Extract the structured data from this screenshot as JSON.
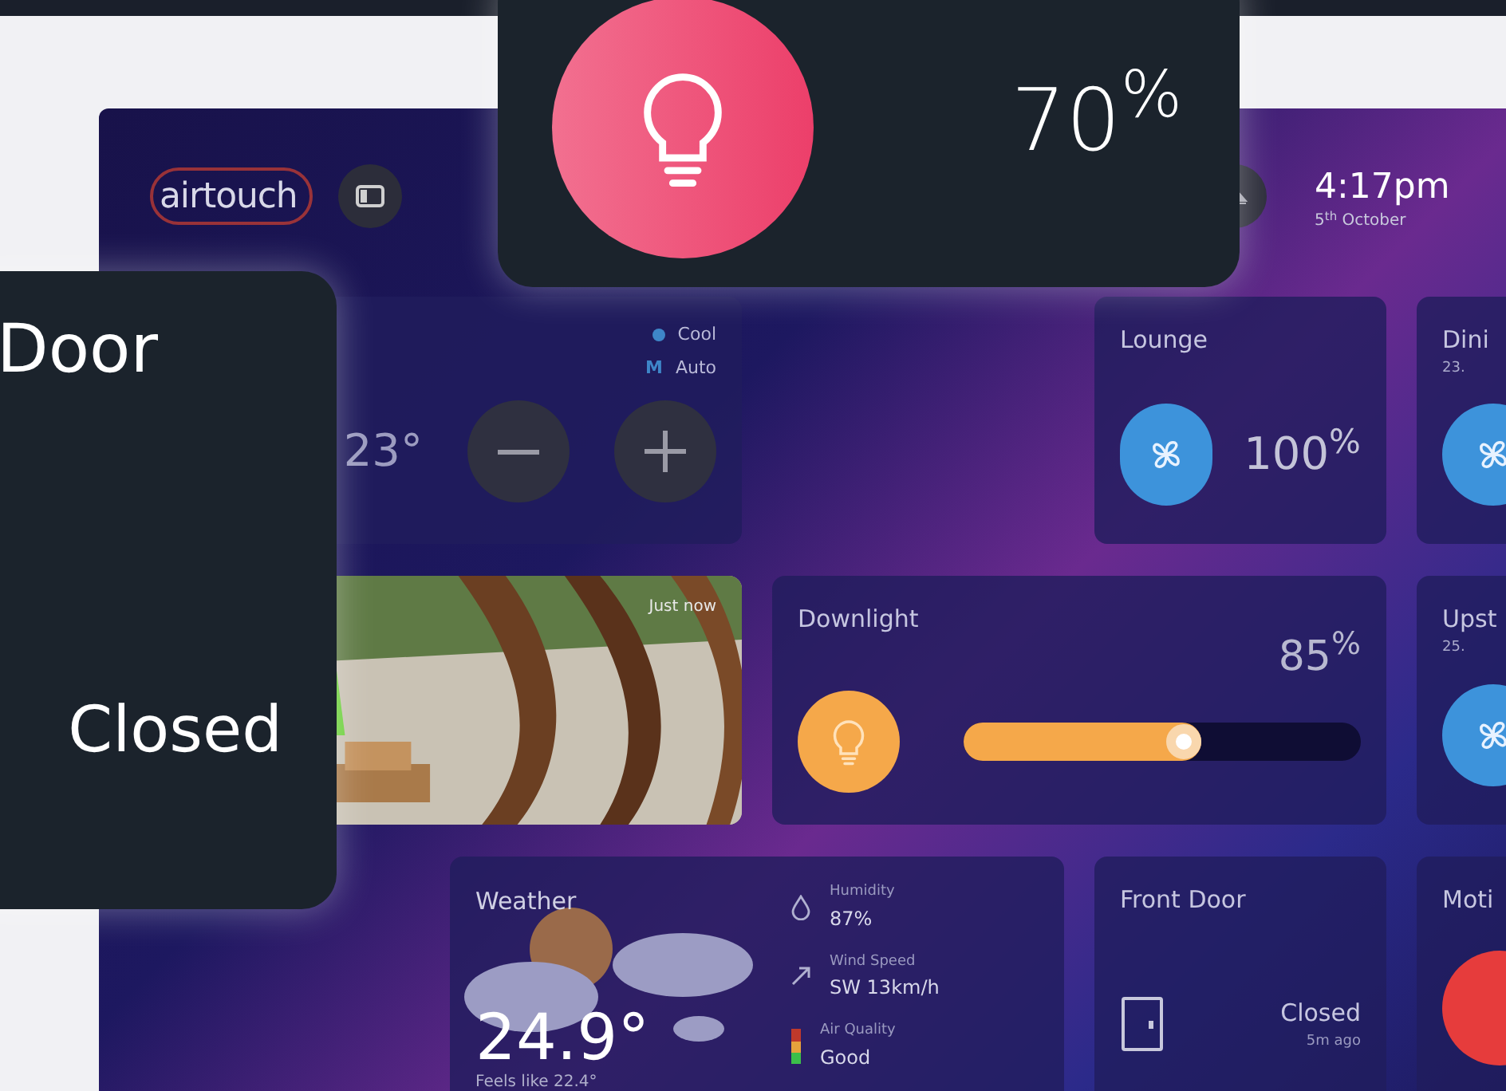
{
  "header": {
    "logo": "airtouch",
    "time": "4:17pm",
    "date": "5$^{th}$ October"
  },
  "aircon": {
    "modes": [
      {
        "kind": "dot",
        "label": "Cool"
      },
      {
        "kind": "letter",
        "letter": "M",
        "label": "Auto"
      }
    ],
    "setpoint": "23°"
  },
  "rooms": [
    {
      "name": "Lounge",
      "value": "100$^{%}$"
    },
    {
      "name": "Dini",
      "reading": "23."
    }
  ],
  "camera": {
    "caption": "Just now"
  },
  "downlight": {
    "name": "Downlight",
    "value": "85$^{%}$",
    "level": 0.6
  },
  "upstairs": {
    "name": "Upst",
    "reading": "25."
  },
  "weather": {
    "title": "Weather",
    "temperature": "24.9°",
    "feels_like": "Feels like 22.4°",
    "stats": [
      {
        "kind": "humidity",
        "label": "Humidity",
        "value": "87%"
      },
      {
        "kind": "wind",
        "label": "Wind Speed",
        "value": "SW 13km/h"
      },
      {
        "kind": "air",
        "label": "Air Quality",
        "value": "Good"
      }
    ]
  },
  "front_door": {
    "name": "Front Door",
    "state": "Closed",
    "time": "5m ago"
  },
  "motion": {
    "name": "Moti",
    "on": true
  },
  "overlays": {
    "light": {
      "value": "70$^{%}$"
    },
    "door": {
      "name": "Door",
      "state": "Closed"
    }
  }
}
